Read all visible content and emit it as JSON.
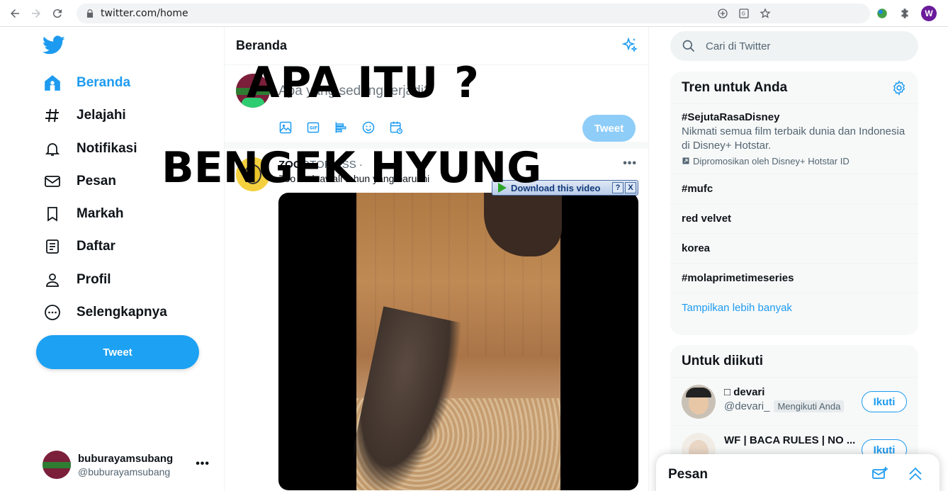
{
  "browser": {
    "url": "twitter.com/home",
    "profile_initial": "W"
  },
  "sidebar": {
    "items": [
      {
        "label": "Beranda",
        "icon": "home-icon",
        "active": true
      },
      {
        "label": "Jelajahi",
        "icon": "hashtag-icon"
      },
      {
        "label": "Notifikasi",
        "icon": "bell-icon"
      },
      {
        "label": "Pesan",
        "icon": "mail-icon"
      },
      {
        "label": "Markah",
        "icon": "bookmark-icon"
      },
      {
        "label": "Daftar",
        "icon": "list-icon"
      },
      {
        "label": "Profil",
        "icon": "person-icon"
      },
      {
        "label": "Selengkapnya",
        "icon": "more-circle-icon"
      }
    ],
    "tweet_label": "Tweet",
    "account": {
      "name": "buburayamsubang",
      "handle": "@buburayamsubang",
      "more": "•••"
    }
  },
  "main": {
    "title": "Beranda",
    "compose": {
      "placeholder": "Apa yang sedang terjadi?",
      "tweet_label": "Tweet"
    },
    "post": {
      "name": "ZOO",
      "name_rest": "OTOR     ESS · ",
      "subtitle": "Zoo    ntuk awali tahun yang baru ini ",
      "more": "•••"
    },
    "download_bar": {
      "label": "Download this video",
      "help": "?",
      "close": "X"
    }
  },
  "overlay": {
    "line1": "APA ITU ?",
    "line2": "BENGEK HYUNG"
  },
  "right": {
    "search_placeholder": "Cari di Twitter",
    "trends_title": "Tren untuk Anda",
    "trends": [
      {
        "title": "#SejutaRasaDisney",
        "desc": "Nikmati semua film terbaik dunia dan Indonesia di Disney+ Hotstar.",
        "promo": "Dipromosikan oleh Disney+ Hotstar ID"
      },
      {
        "title": "#mufc"
      },
      {
        "title": "red velvet"
      },
      {
        "title": "korea"
      },
      {
        "title": "#molaprimetimeseries"
      }
    ],
    "show_more": "Tampilkan lebih banyak",
    "follow_title": "Untuk diikuti",
    "follow": [
      {
        "name": "□ devari",
        "handle": "@devari_",
        "badge": "Mengikuti Anda",
        "button": "Ikuti"
      },
      {
        "name": "WF | BACA RULES | NO ...",
        "button": "Ikuti"
      }
    ]
  },
  "drawer": {
    "title": "Pesan"
  },
  "colors": {
    "accent": "#1d9bf0",
    "tweet_button": "#1da1f2",
    "tweet_disabled": "#8ecdf8"
  }
}
